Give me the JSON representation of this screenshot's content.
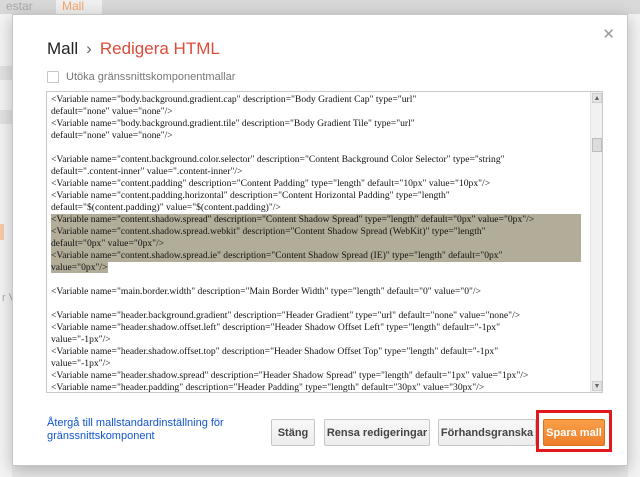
{
  "background": {
    "tab_inactive": "estar",
    "tab_active": "Mall",
    "left_fragment": "r V"
  },
  "dialog": {
    "title_parent": "Mall",
    "title_separator": "›",
    "title_current": "Redigera HTML",
    "close_glyph": "✕",
    "expand_widgets_label": "Utöka gränssnittskomponentmallar",
    "expand_widgets_checked": false
  },
  "editor": {
    "lines": [
      "  <Variable name=\"body.background.gradient.cap\" description=\"Body Gradient Cap\" type=\"url\"",
      "    default=\"none\" value=\"none\"/>",
      "  <Variable name=\"body.background.gradient.tile\" description=\"Body Gradient Tile\" type=\"url\"",
      "    default=\"none\" value=\"none\"/>",
      "",
      "  <Variable name=\"content.background.color.selector\" description=\"Content Background Color Selector\" type=\"string\"",
      "default=\".content-inner\" value=\".content-inner\"/>",
      "  <Variable name=\"content.padding\" description=\"Content Padding\" type=\"length\" default=\"10px\" value=\"10px\"/>",
      "  <Variable name=\"content.padding.horizontal\" description=\"Content Horizontal Padding\" type=\"length\"",
      "default=\"$(content.padding)\" value=\"$(content.padding)\"/>",
      "  <Variable name=\"content.shadow.spread\" description=\"Content Shadow Spread\" type=\"length\" default=\"0px\" value=\"0px\"/>",
      "  <Variable name=\"content.shadow.spread.webkit\" description=\"Content Shadow Spread (WebKit)\" type=\"length\"",
      "default=\"0px\" value=\"0px\"/>",
      "  <Variable name=\"content.shadow.spread.ie\" description=\"Content Shadow Spread (IE)\" type=\"length\" default=\"0px\"",
      "value=\"0px\"/>",
      "",
      "  <Variable name=\"main.border.width\" description=\"Main Border Width\" type=\"length\" default=\"0\" value=\"0\"/>",
      "",
      "  <Variable name=\"header.background.gradient\" description=\"Header Gradient\" type=\"url\" default=\"none\" value=\"none\"/>",
      "  <Variable name=\"header.shadow.offset.left\" description=\"Header Shadow Offset Left\" type=\"length\" default=\"-1px\"",
      "value=\"-1px\"/>",
      "  <Variable name=\"header.shadow.offset.top\" description=\"Header Shadow Offset Top\" type=\"length\" default=\"-1px\"",
      "value=\"-1px\"/>",
      "  <Variable name=\"header.shadow.spread\" description=\"Header Shadow Spread\" type=\"length\" default=\"1px\" value=\"1px\"/>",
      "  <Variable name=\"header.padding\" description=\"Header Padding\" type=\"length\" default=\"30px\" value=\"30px\"/>"
    ],
    "selected_lines": [
      10,
      11,
      12,
      13,
      14
    ]
  },
  "footer": {
    "reset_link": "Återgå till mallstandardinställning för gränssnittskomponent",
    "close_button": "Stäng",
    "clear_button": "Rensa redigeringar",
    "preview_button": "Förhandsgranska",
    "save_button": "Spara mall"
  },
  "colors": {
    "accent_title": "#dd4b39",
    "save_button": "#f08b36",
    "highlight_box": "#e0191f",
    "selection": "#b2ad98",
    "link": "#1155cc"
  }
}
